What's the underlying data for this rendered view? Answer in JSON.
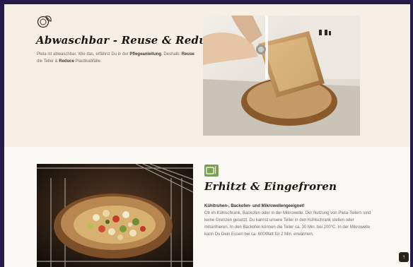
{
  "colors": {
    "outer_background": "#251c4d",
    "section_top": "#f5efe6",
    "section_bottom": "#faf8f5",
    "title": "#1a1712",
    "body_text": "#6d6a66",
    "icon_green": "#7aa24d"
  },
  "section_reusable": {
    "icon": "plate-leaf-icon",
    "title": "Abwaschbar - Reuse & Reduce",
    "text_1": "Pleta ist abwaschbar. Wie das, erfährst Du in der ",
    "text_bold_1": "Pflegeanleitung",
    "text_2": ". Deshalb: ",
    "text_bold_2": "Reuse",
    "text_3": " die Teller & ",
    "text_bold_3": "Reduce",
    "text_4": " Plastikabfälle.",
    "image": "washing-plate-photo"
  },
  "section_heat": {
    "icon": "microwave-icon",
    "title": "Erhitzt & Eingefroren",
    "lead": "Kühltruhen-, Backofen- und Mikrowellengeeignet!",
    "body": "Ob im Kühlschrank, Backofen oder in der Mikrowelle: Der Nutzung von Pleta-Tellern sind keine Grenzen gesetzt. Du kannst unsere Teller in den Kühlschrank stellen oder mitsinfrieren. In den Backofen können die Teller ca. 30 Min. bei 200°C. In der Mikrowelle kann Du Dein Essen bei ca. 600Watt für 2 Min. erwärmen.",
    "image": "oven-plate-photo"
  },
  "scroll_top": {
    "icon": "arrow-up-icon",
    "glyph": "↑"
  }
}
